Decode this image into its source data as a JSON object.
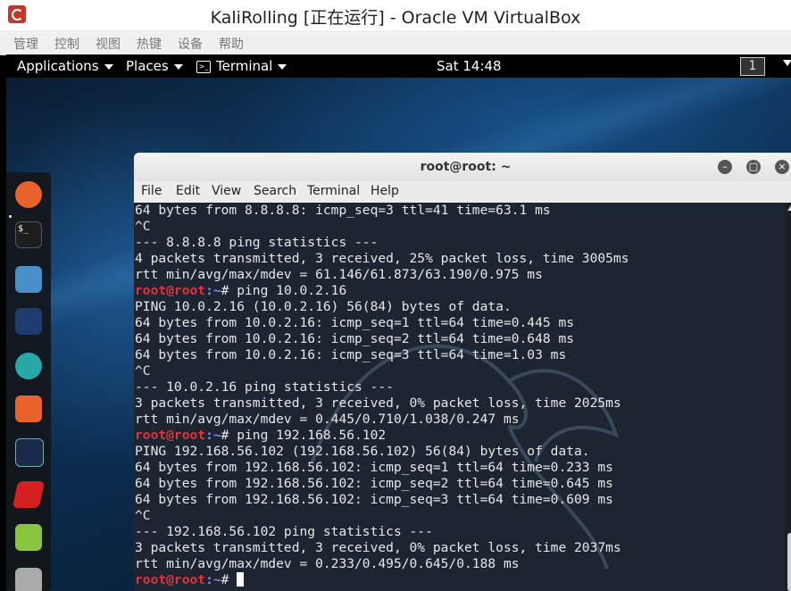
{
  "host": {
    "title": "KaliRolling [正在运行] - Oracle VM VirtualBox",
    "menu": [
      "管理",
      "控制",
      "视图",
      "热键",
      "设备",
      "帮助"
    ]
  },
  "topbar": {
    "applications": "Applications",
    "places": "Places",
    "terminal": "Terminal",
    "clock": "Sat 14:48",
    "workspace": "1"
  },
  "dock": {
    "items": [
      {
        "name": "firefox-icon",
        "color": "#e8632b"
      },
      {
        "name": "terminal-icon",
        "color": "#1d1d1d"
      },
      {
        "name": "files-icon",
        "color": "#4a90c8"
      },
      {
        "name": "metasploit-icon",
        "color": "#1f3a6e"
      },
      {
        "name": "armitage-icon",
        "color": "#2aa7a7"
      },
      {
        "name": "burpsuite-icon",
        "color": "#e8632b"
      },
      {
        "name": "beef-icon",
        "color": "#1a2a4a"
      },
      {
        "name": "faraday-icon",
        "color": "#d42020"
      },
      {
        "name": "leafpad-icon",
        "color": "#8bc53f"
      },
      {
        "name": "calculator-icon",
        "color": "#aaaaaa"
      }
    ]
  },
  "terminal": {
    "title": "root@root: ~",
    "menu": [
      "File",
      "Edit",
      "View",
      "Search",
      "Terminal",
      "Help"
    ],
    "prompt_user": "root@root",
    "prompt_path": ":~",
    "prompt_end": "# ",
    "lines": [
      {
        "text": "64 bytes from 8.8.8.8: icmp_seq=3 ttl=41 time=63.1 ms"
      },
      {
        "text": "^C"
      },
      {
        "text": "--- 8.8.8.8 ping statistics ---"
      },
      {
        "text": "4 packets transmitted, 3 received, 25% packet loss, time 3005ms"
      },
      {
        "text": "rtt min/avg/max/mdev = 61.146/61.873/63.190/0.975 ms"
      },
      {
        "cmd": "ping 10.0.2.16"
      },
      {
        "text": "PING 10.0.2.16 (10.0.2.16) 56(84) bytes of data."
      },
      {
        "text": "64 bytes from 10.0.2.16: icmp_seq=1 ttl=64 time=0.445 ms"
      },
      {
        "text": "64 bytes from 10.0.2.16: icmp_seq=2 ttl=64 time=0.648 ms"
      },
      {
        "text": "64 bytes from 10.0.2.16: icmp_seq=3 ttl=64 time=1.03 ms"
      },
      {
        "text": "^C"
      },
      {
        "text": "--- 10.0.2.16 ping statistics ---"
      },
      {
        "text": "3 packets transmitted, 3 received, 0% packet loss, time 2025ms"
      },
      {
        "text": "rtt min/avg/max/mdev = 0.445/0.710/1.038/0.247 ms"
      },
      {
        "cmd": "ping 192.168.56.102"
      },
      {
        "text": "PING 192.168.56.102 (192.168.56.102) 56(84) bytes of data."
      },
      {
        "text": "64 bytes from 192.168.56.102: icmp_seq=1 ttl=64 time=0.233 ms"
      },
      {
        "text": "64 bytes from 192.168.56.102: icmp_seq=2 ttl=64 time=0.645 ms"
      },
      {
        "text": "64 bytes from 192.168.56.102: icmp_seq=3 ttl=64 time=0.609 ms"
      },
      {
        "text": "^C"
      },
      {
        "text": "--- 192.168.56.102 ping statistics ---"
      },
      {
        "text": "3 packets transmitted, 3 received, 0% packet loss, time 2037ms"
      },
      {
        "text": "rtt min/avg/max/mdev = 0.233/0.495/0.645/0.188 ms"
      },
      {
        "cmd": "",
        "cursor": true
      }
    ]
  }
}
